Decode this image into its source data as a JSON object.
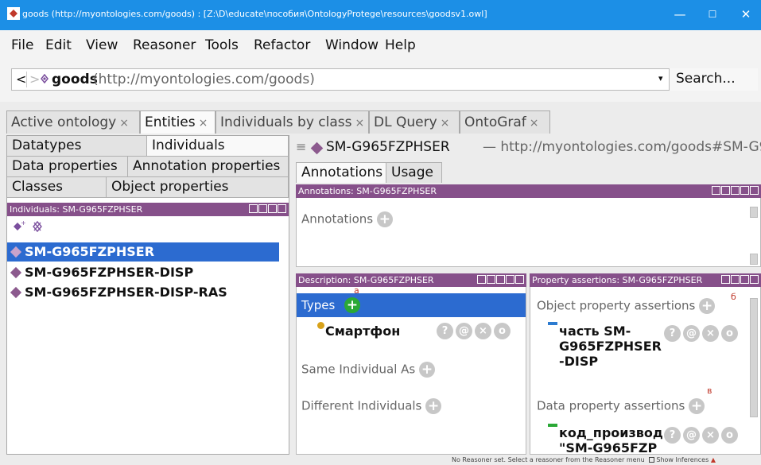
{
  "window": {
    "title": "goods (http://myontologies.com/goods) : [Z:\\D\\educate\\пособия\\OntologyProtege\\resources\\goodsv1.owl]",
    "minimize": "—",
    "maximize": "☐",
    "close": "✕",
    "accent": "#1c8fe6"
  },
  "menu": [
    "File",
    "Edit",
    "View",
    "Reasoner",
    "Tools",
    "Refactor",
    "Window",
    "Help"
  ],
  "nav": {
    "back": "<",
    "forward": ">",
    "ontology_name": "goods",
    "ontology_uri": "(http://myontologies.com/goods)",
    "search_label": "Search..."
  },
  "tabs": [
    {
      "label": "Active ontology",
      "close": "×"
    },
    {
      "label": "Entities",
      "close": "×"
    },
    {
      "label": "Individuals by class",
      "close": "×"
    },
    {
      "label": "DL Query",
      "close": "×"
    },
    {
      "label": "OntoGraf",
      "close": "×"
    }
  ],
  "entity_tabs": {
    "datatypes": "Datatypes",
    "individuals": "Individuals",
    "data_properties": "Data properties",
    "annotation_properties": "Annotation properties",
    "classes": "Classes",
    "object_properties": "Object properties"
  },
  "individuals_panel": {
    "header": "Individuals: SM-G965FZPHSER",
    "items": [
      "SM-G965FZPHSER",
      "SM-G965FZPHSER-DISP",
      "SM-G965FZPHSER-DISP-RAS"
    ],
    "selected_index": 0
  },
  "entity": {
    "hamburger": "≡",
    "name": "SM-G965FZPHSER",
    "uri": "— http://myontologies.com/goods#SM-G9"
  },
  "annotation_tabs": {
    "annotations": "Annotations",
    "usage": "Usage"
  },
  "annotations_panel": {
    "header": "Annotations: SM-G965FZPHSER",
    "label": "Annotations"
  },
  "description_panel": {
    "header": "Description: SM-G965FZPHSER",
    "types_label": "Types",
    "type_item": "Смартфон",
    "same_label": "Same Individual As",
    "different_label": "Different Individuals",
    "marker": "а"
  },
  "property_panel": {
    "header": "Property assertions: SM-G965FZPHSER",
    "object_label": "Object property assertions",
    "object_item_line1": "часть  SM-",
    "object_item_line2": "G965FZPHSER",
    "object_item_line3": "-DISP",
    "data_label": "Data property assertions",
    "data_item_line1": "код_производ",
    "data_item_line2": "\"SM-G965FZP",
    "marker_b": "б",
    "marker_v": "в"
  },
  "action_icons": {
    "help": "?",
    "at": "@",
    "delete": "×",
    "edit": "o"
  },
  "status": {
    "text": "No Reasoner set. Select a reasoner from the Reasoner menu",
    "show_inferences": "Show Inferences"
  }
}
